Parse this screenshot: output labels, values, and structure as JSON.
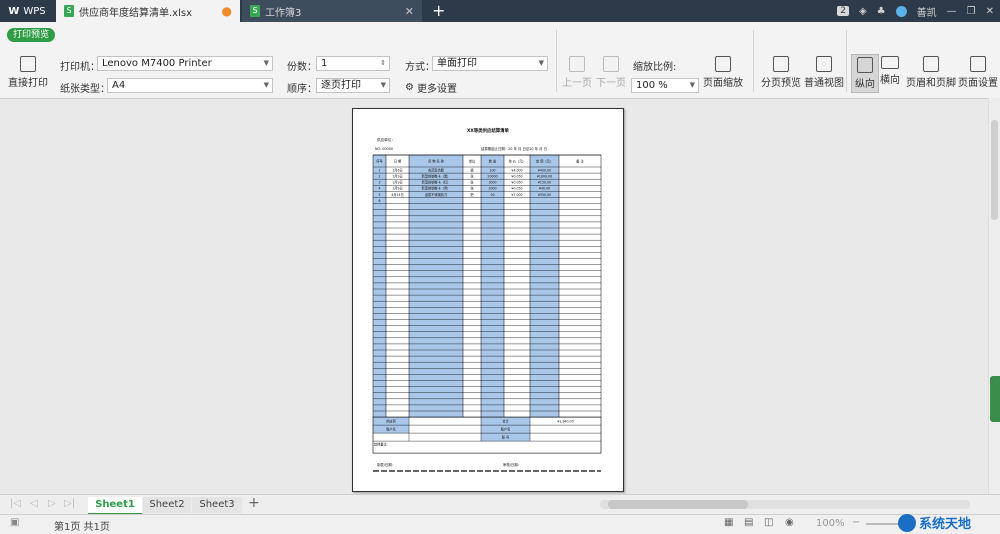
{
  "titlebar": {
    "app_label": "WPS",
    "tabs": [
      {
        "label": "供应商年度结算清单.xlsx",
        "active": true
      },
      {
        "label": "工作簿3",
        "active": false
      }
    ],
    "badge_count": "2",
    "user": "善凯"
  },
  "ribbon": {
    "print_preview": "打印预览",
    "direct_print": "直接打印",
    "printer_label": "打印机：",
    "printer_value": "Lenovo M7400 Printer",
    "paper_label": "纸张类型：",
    "paper_value": "A4",
    "copies_label": "份数：",
    "copies_value": "1",
    "order_label": "顺序：",
    "order_value": "逐页打印",
    "mode_label": "方式：",
    "mode_value": "单面打印",
    "more_settings": "更多设置",
    "prev_page": "上一页",
    "next_page": "下一页",
    "zoom_label": "缩放比例:",
    "zoom_value": "100 %",
    "page_zoom": "页面缩放",
    "page_break_preview": "分页预览",
    "normal_view": "普通视图",
    "portrait": "纵向",
    "landscape": "横向",
    "header_footer": "页眉和页脚",
    "page_setup": "页面设置"
  },
  "document": {
    "title": "XX等类供应结算清单",
    "supplier_label": "供应单位：",
    "no_label": "NO. 00000",
    "period": "结算期起止日期：20   年   月   日至20   年   月   日",
    "headers": [
      "序号",
      "日   期",
      "货  物  名  称",
      "单位",
      "数  量",
      "单 价（元）",
      "金 额（元）",
      "备    注"
    ],
    "rows": [
      [
        "1",
        "1月6日",
        "农药复合肥",
        "袋",
        "100",
        "¥4.000",
        "¥400.00",
        ""
      ],
      [
        "2",
        "1月9日",
        "新型铁钢卷卡（黑）",
        "张",
        "20000",
        "¥0.050",
        "¥1000.00",
        ""
      ],
      [
        "3",
        "1月9日",
        "新型铁钢卷卡（红）",
        "张",
        "3000",
        "¥0.050",
        "¥150.00",
        ""
      ],
      [
        "4",
        "1月9日",
        "新型铁钢卷卡（黄）",
        "张",
        "2000",
        "¥0.050",
        "¥40.00",
        ""
      ],
      [
        "5",
        "4月14日",
        "金属不锈钢剪刀",
        "把",
        "50",
        "¥7.000",
        "¥350.00",
        ""
      ],
      [
        "6",
        "",
        "",
        "",
        "",
        "",
        "",
        ""
      ]
    ],
    "total_label": "合计",
    "total_value": "¥1,940.00",
    "supplier_footer": "供应商",
    "account_name": "账户名",
    "account_holder": "账户名",
    "account_no": "账  号",
    "remarks": "其他备注：",
    "signer_left": "制表/日期：",
    "signer_right": "审核/日期："
  },
  "sheets": {
    "tabs": [
      "Sheet1",
      "Sheet2",
      "Sheet3"
    ],
    "add": "+"
  },
  "status": {
    "page_info": "第1页 共1页",
    "zoom": "100%",
    "watermark": "系统天地"
  },
  "colors": {
    "accent_green": "#2e9d46",
    "titlebar": "#2c3a4a",
    "column_fill": "#a9c7e8",
    "grid": "#000000"
  }
}
